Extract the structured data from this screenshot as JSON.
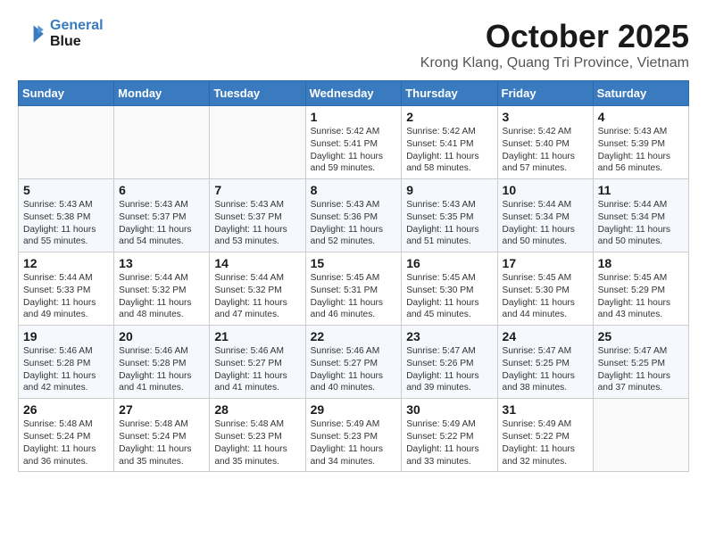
{
  "logo": {
    "line1": "General",
    "line2": "Blue"
  },
  "title": "October 2025",
  "subtitle": "Krong Klang, Quang Tri Province, Vietnam",
  "headers": [
    "Sunday",
    "Monday",
    "Tuesday",
    "Wednesday",
    "Thursday",
    "Friday",
    "Saturday"
  ],
  "weeks": [
    [
      {
        "day": "",
        "content": ""
      },
      {
        "day": "",
        "content": ""
      },
      {
        "day": "",
        "content": ""
      },
      {
        "day": "1",
        "content": "Sunrise: 5:42 AM\nSunset: 5:41 PM\nDaylight: 11 hours\nand 59 minutes."
      },
      {
        "day": "2",
        "content": "Sunrise: 5:42 AM\nSunset: 5:41 PM\nDaylight: 11 hours\nand 58 minutes."
      },
      {
        "day": "3",
        "content": "Sunrise: 5:42 AM\nSunset: 5:40 PM\nDaylight: 11 hours\nand 57 minutes."
      },
      {
        "day": "4",
        "content": "Sunrise: 5:43 AM\nSunset: 5:39 PM\nDaylight: 11 hours\nand 56 minutes."
      }
    ],
    [
      {
        "day": "5",
        "content": "Sunrise: 5:43 AM\nSunset: 5:38 PM\nDaylight: 11 hours\nand 55 minutes."
      },
      {
        "day": "6",
        "content": "Sunrise: 5:43 AM\nSunset: 5:37 PM\nDaylight: 11 hours\nand 54 minutes."
      },
      {
        "day": "7",
        "content": "Sunrise: 5:43 AM\nSunset: 5:37 PM\nDaylight: 11 hours\nand 53 minutes."
      },
      {
        "day": "8",
        "content": "Sunrise: 5:43 AM\nSunset: 5:36 PM\nDaylight: 11 hours\nand 52 minutes."
      },
      {
        "day": "9",
        "content": "Sunrise: 5:43 AM\nSunset: 5:35 PM\nDaylight: 11 hours\nand 51 minutes."
      },
      {
        "day": "10",
        "content": "Sunrise: 5:44 AM\nSunset: 5:34 PM\nDaylight: 11 hours\nand 50 minutes."
      },
      {
        "day": "11",
        "content": "Sunrise: 5:44 AM\nSunset: 5:34 PM\nDaylight: 11 hours\nand 50 minutes."
      }
    ],
    [
      {
        "day": "12",
        "content": "Sunrise: 5:44 AM\nSunset: 5:33 PM\nDaylight: 11 hours\nand 49 minutes."
      },
      {
        "day": "13",
        "content": "Sunrise: 5:44 AM\nSunset: 5:32 PM\nDaylight: 11 hours\nand 48 minutes."
      },
      {
        "day": "14",
        "content": "Sunrise: 5:44 AM\nSunset: 5:32 PM\nDaylight: 11 hours\nand 47 minutes."
      },
      {
        "day": "15",
        "content": "Sunrise: 5:45 AM\nSunset: 5:31 PM\nDaylight: 11 hours\nand 46 minutes."
      },
      {
        "day": "16",
        "content": "Sunrise: 5:45 AM\nSunset: 5:30 PM\nDaylight: 11 hours\nand 45 minutes."
      },
      {
        "day": "17",
        "content": "Sunrise: 5:45 AM\nSunset: 5:30 PM\nDaylight: 11 hours\nand 44 minutes."
      },
      {
        "day": "18",
        "content": "Sunrise: 5:45 AM\nSunset: 5:29 PM\nDaylight: 11 hours\nand 43 minutes."
      }
    ],
    [
      {
        "day": "19",
        "content": "Sunrise: 5:46 AM\nSunset: 5:28 PM\nDaylight: 11 hours\nand 42 minutes."
      },
      {
        "day": "20",
        "content": "Sunrise: 5:46 AM\nSunset: 5:28 PM\nDaylight: 11 hours\nand 41 minutes."
      },
      {
        "day": "21",
        "content": "Sunrise: 5:46 AM\nSunset: 5:27 PM\nDaylight: 11 hours\nand 41 minutes."
      },
      {
        "day": "22",
        "content": "Sunrise: 5:46 AM\nSunset: 5:27 PM\nDaylight: 11 hours\nand 40 minutes."
      },
      {
        "day": "23",
        "content": "Sunrise: 5:47 AM\nSunset: 5:26 PM\nDaylight: 11 hours\nand 39 minutes."
      },
      {
        "day": "24",
        "content": "Sunrise: 5:47 AM\nSunset: 5:25 PM\nDaylight: 11 hours\nand 38 minutes."
      },
      {
        "day": "25",
        "content": "Sunrise: 5:47 AM\nSunset: 5:25 PM\nDaylight: 11 hours\nand 37 minutes."
      }
    ],
    [
      {
        "day": "26",
        "content": "Sunrise: 5:48 AM\nSunset: 5:24 PM\nDaylight: 11 hours\nand 36 minutes."
      },
      {
        "day": "27",
        "content": "Sunrise: 5:48 AM\nSunset: 5:24 PM\nDaylight: 11 hours\nand 35 minutes."
      },
      {
        "day": "28",
        "content": "Sunrise: 5:48 AM\nSunset: 5:23 PM\nDaylight: 11 hours\nand 35 minutes."
      },
      {
        "day": "29",
        "content": "Sunrise: 5:49 AM\nSunset: 5:23 PM\nDaylight: 11 hours\nand 34 minutes."
      },
      {
        "day": "30",
        "content": "Sunrise: 5:49 AM\nSunset: 5:22 PM\nDaylight: 11 hours\nand 33 minutes."
      },
      {
        "day": "31",
        "content": "Sunrise: 5:49 AM\nSunset: 5:22 PM\nDaylight: 11 hours\nand 32 minutes."
      },
      {
        "day": "",
        "content": ""
      }
    ]
  ]
}
